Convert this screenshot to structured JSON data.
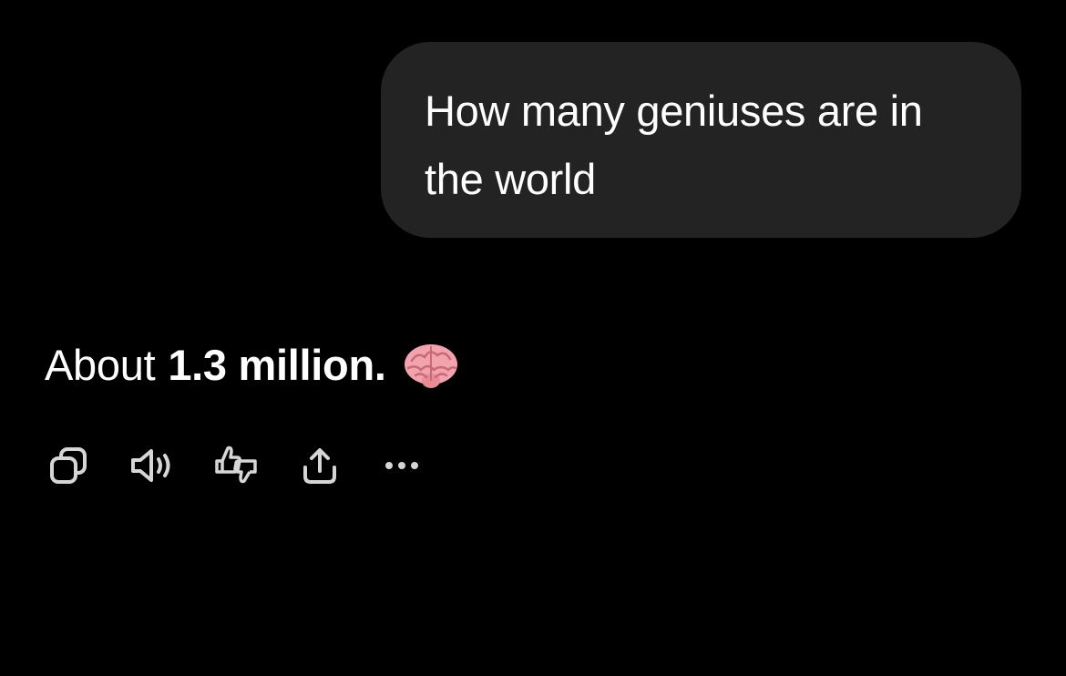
{
  "conversation": {
    "user_message": "How many geniuses are in the world",
    "assistant_reply": {
      "text_plain": "About",
      "text_bold": "1.3 million.",
      "emoji_icon": "brain-icon"
    }
  },
  "actions": [
    {
      "name": "copy-icon"
    },
    {
      "name": "read-aloud-icon"
    },
    {
      "name": "feedback-thumbs-icon"
    },
    {
      "name": "share-icon"
    },
    {
      "name": "more-icon"
    }
  ],
  "colors": {
    "background": "#000000",
    "bubble": "#232323",
    "text": "#ffffff",
    "icon": "#d6d6d6",
    "brain": "#f2a3ad"
  }
}
